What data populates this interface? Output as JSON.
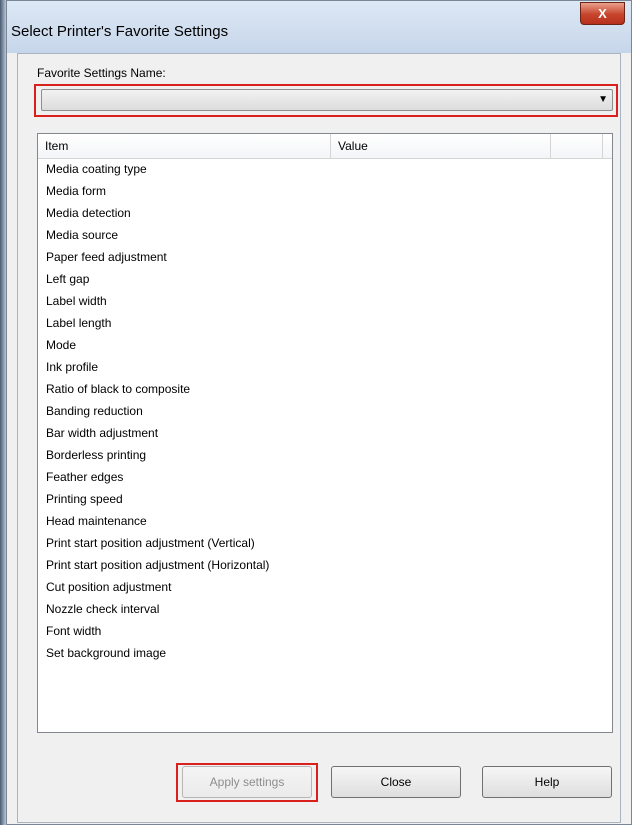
{
  "window": {
    "title": "Select Printer's Favorite Settings",
    "close_symbol": "X"
  },
  "favorite": {
    "label": "Favorite Settings Name:",
    "value": "",
    "arrow_icon": "dropdown-arrow-icon",
    "arrow_glyph": "▼"
  },
  "list": {
    "columns": [
      "Item",
      "Value"
    ],
    "rows": [
      "Media coating type",
      "Media form",
      "Media detection",
      "Media source",
      "Paper feed adjustment",
      "Left gap",
      "Label width",
      "Label length",
      "Mode",
      "Ink profile",
      "Ratio of black to composite",
      "Banding reduction",
      "Bar width adjustment",
      "Borderless printing",
      "Feather edges",
      "Printing speed",
      "Head maintenance",
      "Print start position adjustment (Vertical)",
      "Print start position adjustment (Horizontal)",
      "Cut position adjustment",
      "Nozzle check interval",
      "Font width",
      "Set background image"
    ]
  },
  "buttons": {
    "apply": "Apply settings",
    "close": "Close",
    "help": "Help"
  },
  "colors": {
    "highlight": "#d9201c",
    "close_button": "#c7442c"
  }
}
